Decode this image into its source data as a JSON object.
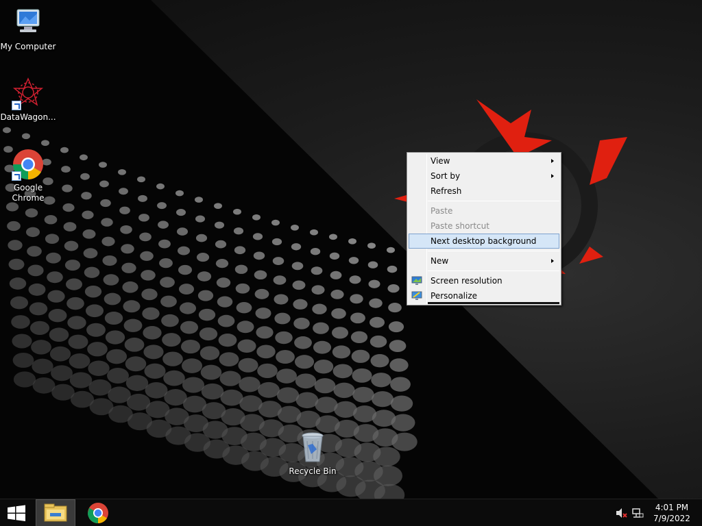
{
  "desktop": {
    "icons": [
      {
        "label": "My Computer"
      },
      {
        "label": "DataWagon..."
      },
      {
        "label": "Google Chrome"
      },
      {
        "label": "Recycle Bin"
      }
    ]
  },
  "context_menu": {
    "items": [
      {
        "label": "View",
        "submenu": true,
        "enabled": true
      },
      {
        "label": "Sort by",
        "submenu": true,
        "enabled": true
      },
      {
        "label": "Refresh",
        "submenu": false,
        "enabled": true
      },
      {
        "label": "Paste",
        "submenu": false,
        "enabled": false
      },
      {
        "label": "Paste shortcut",
        "submenu": false,
        "enabled": false
      },
      {
        "label": "Next desktop background",
        "submenu": false,
        "enabled": true,
        "highlighted": true
      },
      {
        "label": "New",
        "submenu": true,
        "enabled": true
      },
      {
        "label": "Screen resolution",
        "submenu": false,
        "enabled": true,
        "icon": "monitor-icon"
      },
      {
        "label": "Personalize",
        "submenu": false,
        "enabled": true,
        "icon": "personalize-icon"
      }
    ]
  },
  "taskbar": {
    "pinned": [
      {
        "name": "file-explorer",
        "icon": "folder-icon",
        "active": true
      },
      {
        "name": "google-chrome",
        "icon": "chrome-icon",
        "active": false
      }
    ],
    "tray": {
      "icons": [
        "volume-muted-icon",
        "network-icon"
      ]
    },
    "clock": {
      "time": "4:01 PM",
      "date": "7/9/2022"
    }
  },
  "colors": {
    "menu_background": "#f0f0f0",
    "menu_highlight": "#d5e6f7",
    "menu_highlight_border": "#7da2ce",
    "disabled_text": "#8a8a8a",
    "taskbar": "#0b0b0b",
    "accent_red": "#e02010"
  }
}
